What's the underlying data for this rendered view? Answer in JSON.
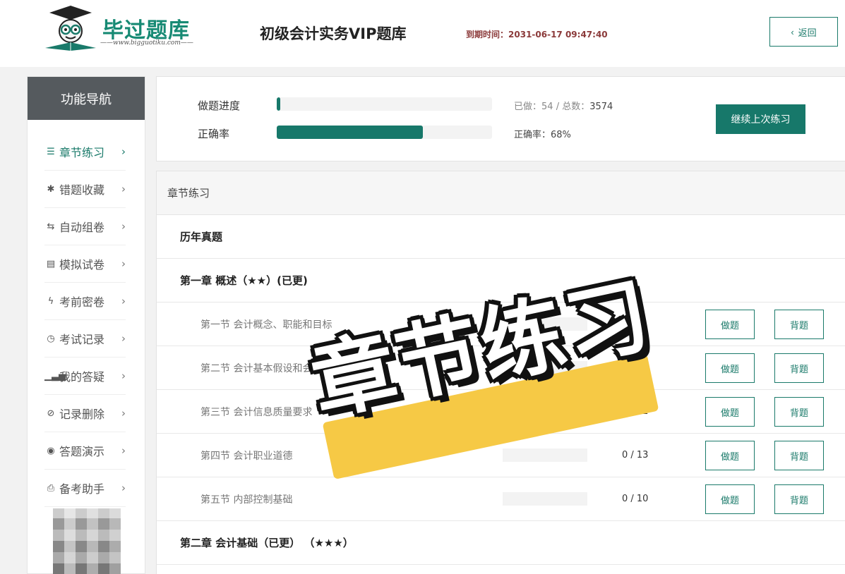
{
  "header": {
    "site_title": "初级会计实务VIP题库",
    "logo_brand": "毕过题库",
    "logo_url": "——www.bigguotiku.com——",
    "expiry_label": "到期时间：",
    "expiry_value": "2031-06-17 09:47:40",
    "back_label": "返回"
  },
  "sidebar": {
    "title": "功能导航",
    "items": [
      {
        "label": "章节练习",
        "icon": "list-icon",
        "active": true
      },
      {
        "label": "错题收藏",
        "icon": "asterisk-icon"
      },
      {
        "label": "自动组卷",
        "icon": "retweet-icon"
      },
      {
        "label": "模拟试卷",
        "icon": "document-icon"
      },
      {
        "label": "考前密卷",
        "icon": "bolt-icon"
      },
      {
        "label": "考试记录",
        "icon": "clock-icon"
      },
      {
        "label": "我的答疑",
        "icon": "bar-chart-icon"
      },
      {
        "label": "记录删除",
        "icon": "ban-icon"
      },
      {
        "label": "答题演示",
        "icon": "globe-icon"
      },
      {
        "label": "备考助手",
        "icon": "printer-icon"
      }
    ]
  },
  "progress": {
    "done_label": "做题进度",
    "accuracy_label": "正确率",
    "done_prefix": "已做：",
    "done_value": "54",
    "total_prefix": " / 总数：",
    "total_value": "3574",
    "done_fraction": 0.015,
    "accuracy_text": "正确率：68%",
    "accuracy_fraction": 0.68,
    "continue_label": "继续上次练习"
  },
  "chapters": {
    "panel_title": "章节练习",
    "rows": [
      {
        "kind": "chapter",
        "title": "历年真题"
      },
      {
        "kind": "chapter",
        "title": "第一章 概述（★★）(已更)"
      },
      {
        "kind": "section",
        "title": "第一节 会计概念、职能和目标",
        "count": "",
        "fraction": 0.3
      },
      {
        "kind": "section",
        "title": "第二节 会计基本假设和会计基础",
        "count": "",
        "fraction": 0
      },
      {
        "kind": "section",
        "title": "第三节 会计信息质量要求",
        "count": "0 / 12",
        "fraction": 0
      },
      {
        "kind": "section",
        "title": "第四节 会计职业道德",
        "count": "0 / 13",
        "fraction": 0
      },
      {
        "kind": "section",
        "title": "第五节 内部控制基础",
        "count": "0 / 10",
        "fraction": 0
      },
      {
        "kind": "chapter",
        "title": "第二章 会计基础（已更） （★★★）"
      }
    ],
    "do_label": "做题",
    "memo_label": "背题"
  },
  "overlay": {
    "text": "章节练习"
  },
  "colors": {
    "accent": "#17786a",
    "sidebar_header": "#555a5e",
    "expiry": "#8b3a3a",
    "overlay_stripe": "#f6c945"
  }
}
